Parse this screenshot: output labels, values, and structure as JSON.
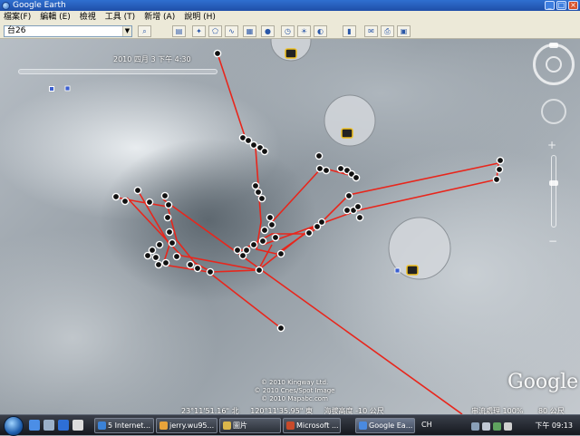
{
  "window": {
    "title": "Google Earth",
    "minimize": "_",
    "maximize": "□",
    "close": "×"
  },
  "menu": [
    "檔案(F)",
    "編輯 (E)",
    "檢視",
    "工具 (T)",
    "新增 (A)",
    "說明 (H)"
  ],
  "toolbar": {
    "search_value": "台26",
    "dropdown_icon": "▼",
    "search_icon": "⌕",
    "buttons": [
      {
        "name": "sidebar-toggle-button",
        "glyph": "▤"
      },
      {
        "name": "placemark-button",
        "glyph": "✦"
      },
      {
        "name": "polygon-button",
        "glyph": "⬠"
      },
      {
        "name": "path-button",
        "glyph": "∿"
      },
      {
        "name": "overlay-button",
        "glyph": "▦"
      },
      {
        "name": "tour-button",
        "glyph": "●"
      },
      {
        "name": "historical-imagery-button",
        "glyph": "◷"
      },
      {
        "name": "sunlight-button",
        "glyph": "☀"
      },
      {
        "name": "switch-sky-button",
        "glyph": "◐"
      },
      {
        "name": "ruler-button",
        "glyph": "▮"
      },
      {
        "name": "email-button",
        "glyph": "✉"
      },
      {
        "name": "print-button",
        "glyph": "⎙"
      },
      {
        "name": "view-in-maps-button",
        "glyph": "▣"
      }
    ]
  },
  "map": {
    "timestamp": "2010 四月 3 下午 4:30",
    "attribution": [
      "© 2010 Kingway Ltd.",
      "© 2010 Cnes/Spot Image",
      "© 2010 Mapabc.com"
    ],
    "logo": "Google",
    "status": {
      "lat": "23°11'51.16\" 北",
      "lon": "120°11'35.95\" 東",
      "elev": "海拔高度 -10 公尺"
    },
    "streaming": "串流處理 100%",
    "eye_alt": "80 公尺",
    "track_color": "#e8261c"
  },
  "taskbar": {
    "language": "CH",
    "time": "下午 09:13",
    "buttons": [
      {
        "label": "5 Internet...",
        "color": "#3b82d6"
      },
      {
        "label": "jerry.wu95...",
        "color": "#e8a33a"
      },
      {
        "label": "圖片",
        "color": "#d9b64a"
      },
      {
        "label": "Microsoft ...",
        "color": "#c84a2a"
      },
      {
        "label": "Google Ea...",
        "color": "#4a8ae0"
      }
    ]
  }
}
